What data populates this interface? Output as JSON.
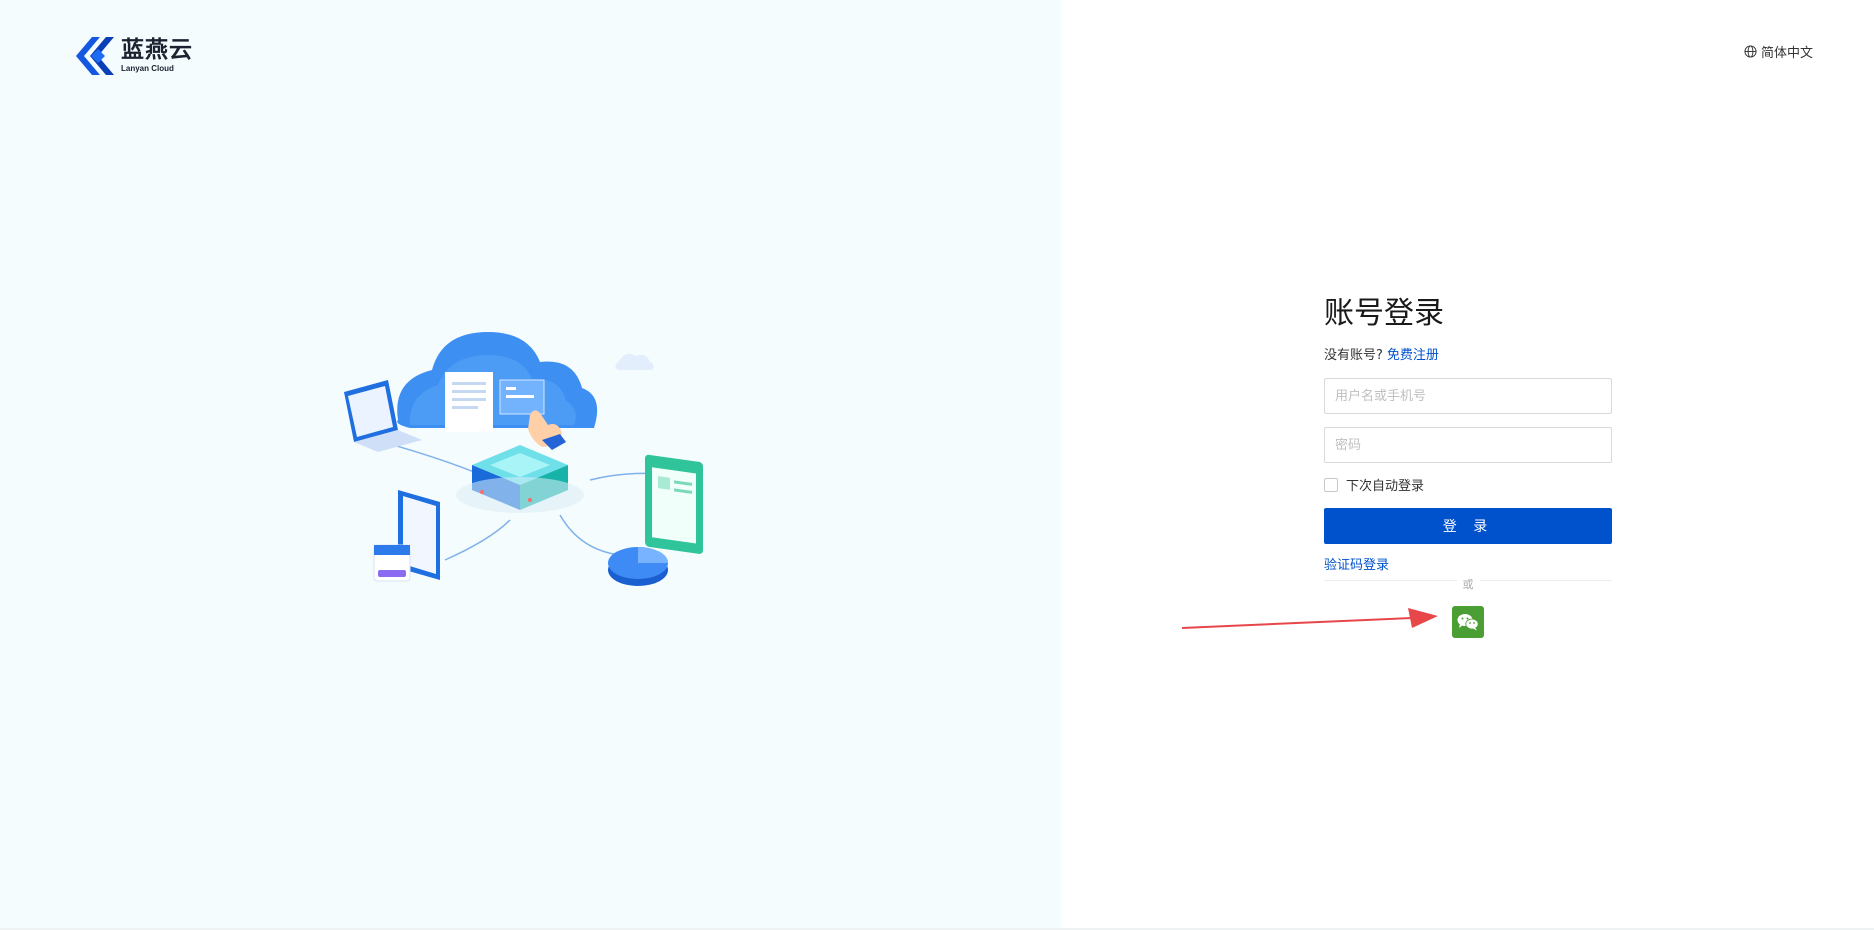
{
  "brand": {
    "name_cn": "蓝燕云",
    "name_en": "Lanyan Cloud",
    "color": "#0052cc"
  },
  "header": {
    "language_label": "简体中文",
    "language_icon": "globe-icon"
  },
  "login": {
    "title": "账号登录",
    "no_account_text": "没有账号?",
    "register_link": "免费注册",
    "username_placeholder": "用户名或手机号",
    "password_placeholder": "密码",
    "remember_label": "下次自动登录",
    "remember_checked": false,
    "submit_label": "登 录",
    "sms_login_link": "验证码登录",
    "divider_text": "或",
    "wechat_icon": "wechat-icon"
  },
  "colors": {
    "primary": "#0052cc",
    "wechat": "#4b9e33",
    "annotation_arrow": "#e8474a",
    "left_background": "#f5fcfd"
  }
}
